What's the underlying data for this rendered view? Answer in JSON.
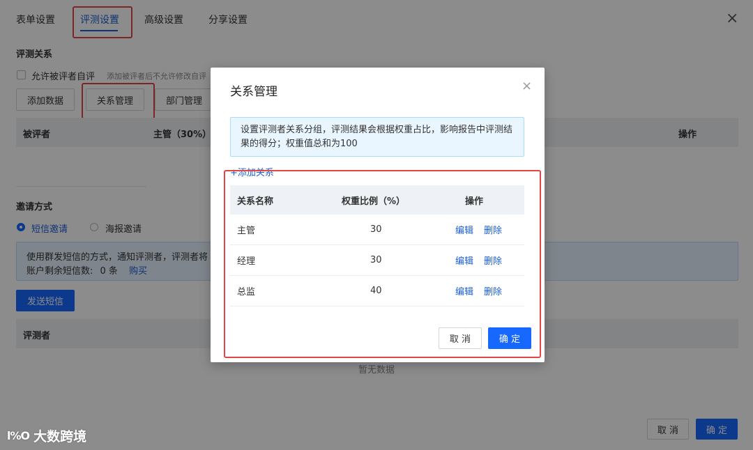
{
  "tabs": [
    {
      "label": "表单设置"
    },
    {
      "label": "评测设置"
    },
    {
      "label": "高级设置"
    },
    {
      "label": "分享设置"
    }
  ],
  "relation_section": {
    "title": "评测关系",
    "self_eval_label": "允许被评者自评",
    "self_eval_hint": "添加被评者后不允许修改自评",
    "buttons": {
      "add_data": "添加数据",
      "relation_manage": "关系管理",
      "dept_manage": "部门管理"
    },
    "table": {
      "col_evaluatee": "被评者",
      "col_supervisor": "主管（30%）",
      "col_action": "操作"
    }
  },
  "invite_section": {
    "title": "邀请方式",
    "options": [
      {
        "label": "短信邀请",
        "selected": true
      },
      {
        "label": "海报邀请",
        "selected": false
      }
    ],
    "info_line1": "使用群发短信的方式，通知评测者，评测者将",
    "info_line2_prefix": "账户剩余短信数:",
    "info_line2_count": "0 条",
    "buy_link": "购买",
    "send_button": "发送短信",
    "table": {
      "col_evaluator": "评测者"
    },
    "empty_text": "暂无数据"
  },
  "footer": {
    "cancel": "取 消",
    "confirm": "确 定"
  },
  "modal": {
    "title": "关系管理",
    "close_icon": "×",
    "notice": "设置评测者关系分组，评测结果会根据权重占比，影响报告中评测结果的得分；权重值总和为100",
    "add_link": "+添加关系",
    "columns": {
      "name": "关系名称",
      "weight": "权重比例（%）",
      "action": "操作"
    },
    "rows": [
      {
        "name": "主管",
        "weight": "30",
        "edit": "编辑",
        "delete": "删除"
      },
      {
        "name": "经理",
        "weight": "30",
        "edit": "编辑",
        "delete": "删除"
      },
      {
        "name": "总监",
        "weight": "40",
        "edit": "编辑",
        "delete": "删除"
      }
    ],
    "cancel": "取 消",
    "confirm": "确 定"
  },
  "watermark": {
    "logo": "l%O",
    "text": "大数跨境"
  },
  "colors": {
    "primary": "#1668ff",
    "link": "#1a5fd6",
    "highlight": "#e04646"
  }
}
